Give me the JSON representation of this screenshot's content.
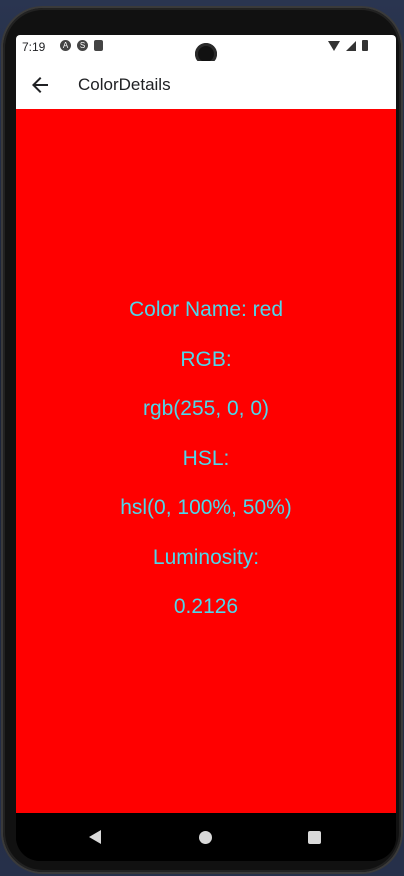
{
  "status_bar": {
    "time": "7:19",
    "left_icons": [
      "app-a-icon",
      "app-s-icon",
      "sd-card-icon"
    ],
    "right_icons": [
      "wifi-icon",
      "signal-icon",
      "battery-icon"
    ]
  },
  "app_bar": {
    "title": "ColorDetails",
    "back_icon": "arrow-left-icon"
  },
  "color_details": {
    "background_color": "#ff0000",
    "text_color": "#4fd7ea",
    "name_line": "Color Name: red",
    "rgb_label": "RGB:",
    "rgb_value": "rgb(255, 0, 0)",
    "hsl_label": "HSL:",
    "hsl_value": "hsl(0, 100%, 50%)",
    "luminosity_label": "Luminosity:",
    "luminosity_value": "0.2126"
  },
  "nav_bar": {
    "buttons": [
      "back-triangle-icon",
      "home-circle-icon",
      "recents-square-icon"
    ]
  }
}
